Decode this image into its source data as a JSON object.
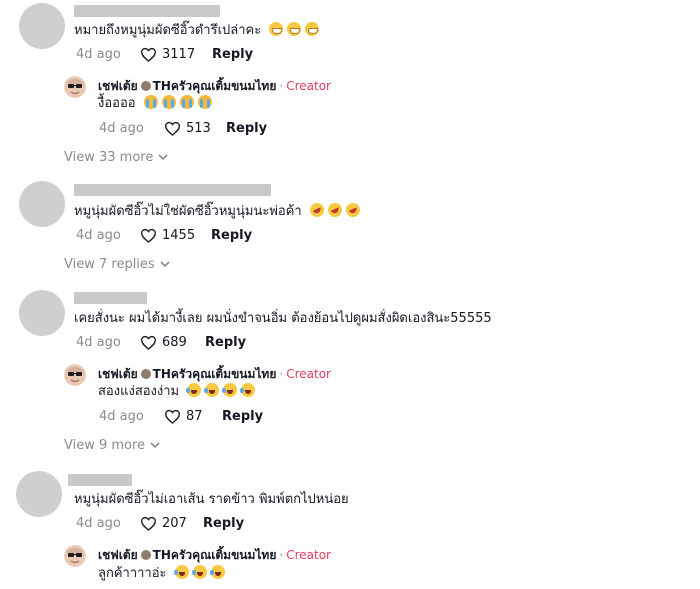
{
  "creator": {
    "name": "เชฟเต้ย",
    "suffix": "THครัวคุณเติ้มขนมไทย",
    "separator": "·",
    "badge": "Creator"
  },
  "comments": [
    {
      "text": "หมายถึงหมูนุ่มผัดซีอิ๊วดำรึเปล่าคะ",
      "emojis": [
        "grin",
        "grin",
        "grin"
      ],
      "date": "4d ago",
      "likes": "3117",
      "reply_label": "Reply",
      "reply": {
        "text": "งื้ออออ",
        "emojis": [
          "cry",
          "cry",
          "cry",
          "cry"
        ],
        "date": "4d ago",
        "likes": "513",
        "reply_label": "Reply"
      },
      "view_more": "View 33 more"
    },
    {
      "text": "หมูนุ่มผัดซีอิ๊วไม่ใช่ผัดซีอิ๊วหมูนุ่มนะพ่อค้า",
      "emojis": [
        "rofl",
        "rofl",
        "rofl"
      ],
      "date": "4d ago",
      "likes": "1455",
      "reply_label": "Reply",
      "view_more": "View 7 replies"
    },
    {
      "text": "เคยสั่งนะ ผมได้มางี้เลย ผมนั่งขำจนอิ่ม ต้องย้อนไปดูผมสั่งผิดเองสินะ55555",
      "emojis": [],
      "date": "4d ago",
      "likes": "689",
      "reply_label": "Reply",
      "reply": {
        "text": "สองแง่สองง่าม",
        "emojis": [
          "joy",
          "joy",
          "joy",
          "joy"
        ],
        "date": "4d ago",
        "likes": "87",
        "reply_label": "Reply"
      },
      "view_more": "View 9 more"
    },
    {
      "text": "หมูนุ่มผัดซีอิ๊วไม่เอาเส้น ราดข้าว พิมพ์ตกไปหน่อย",
      "emojis": [],
      "date": "4d ago",
      "likes": "207",
      "reply_label": "Reply",
      "reply": {
        "text": "ลูกค้าาาาอ่ะ",
        "emojis": [
          "joy",
          "joy",
          "joy"
        ]
      }
    }
  ]
}
